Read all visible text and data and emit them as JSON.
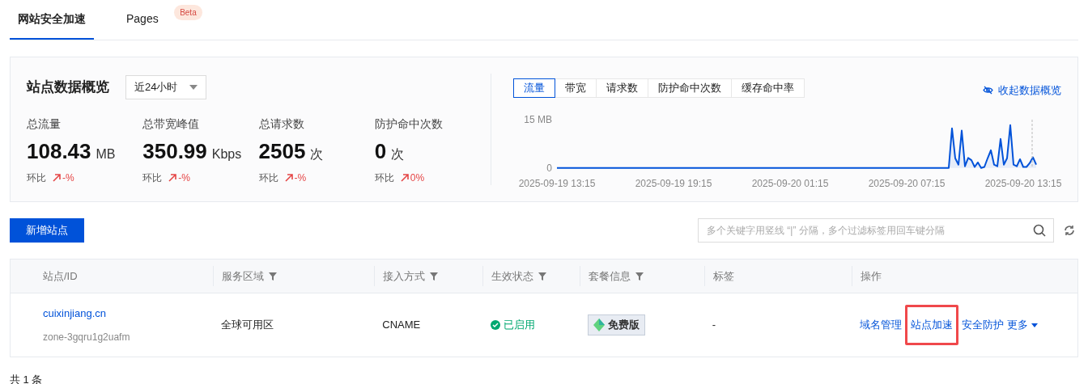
{
  "tabs": [
    {
      "label": "网站安全加速",
      "selected": true
    },
    {
      "label": "Pages",
      "selected": false,
      "badge": "Beta"
    }
  ],
  "overview": {
    "title": "站点数据概览",
    "range": "近24小时",
    "metrics": [
      {
        "label": "总流量",
        "value": "108.43",
        "unit": "MB",
        "compare_label": "环比",
        "compare": "-%"
      },
      {
        "label": "总带宽峰值",
        "value": "350.99",
        "unit": "Kbps",
        "compare_label": "环比",
        "compare": "-%"
      },
      {
        "label": "总请求数",
        "value": "2505",
        "unit": "次",
        "compare_label": "环比",
        "compare": "-%"
      },
      {
        "label": "防护命中次数",
        "value": "0",
        "unit": "次",
        "compare_label": "环比",
        "compare": "0%"
      }
    ],
    "chart_tabs": [
      {
        "label": "流量",
        "selected": true
      },
      {
        "label": "带宽",
        "selected": false
      },
      {
        "label": "请求数",
        "selected": false
      },
      {
        "label": "防护命中次数",
        "selected": false
      },
      {
        "label": "缓存命中率",
        "selected": false
      }
    ],
    "collapse_link": "收起数据概览",
    "chart_data": {
      "type": "line",
      "categories": [
        "2025-09-19 13:15",
        null,
        null,
        null,
        null,
        null,
        null,
        null,
        null,
        null,
        null,
        null,
        null,
        null,
        null,
        null,
        null,
        null,
        null,
        null,
        null,
        null,
        null,
        null,
        null,
        null,
        null,
        null,
        null,
        null,
        null,
        null,
        null,
        null,
        null,
        null,
        "2025-09-19 19:15",
        null,
        null,
        null,
        null,
        null,
        null,
        null,
        null,
        null,
        null,
        null,
        null,
        null,
        null,
        null,
        null,
        null,
        null,
        null,
        null,
        null,
        null,
        null,
        null,
        null,
        null,
        null,
        null,
        null,
        null,
        null,
        null,
        null,
        null,
        null,
        "2025-09-20 01:15",
        null,
        null,
        null,
        null,
        null,
        null,
        null,
        null,
        null,
        null,
        null,
        null,
        null,
        null,
        null,
        null,
        null,
        null,
        null,
        null,
        null,
        null,
        null,
        null,
        null,
        null,
        null,
        null,
        null,
        null,
        null,
        null,
        null,
        null,
        null,
        "2025-09-20 07:15",
        null,
        null,
        null,
        null,
        null,
        null,
        null,
        null,
        null,
        null,
        null,
        null,
        null,
        null,
        null,
        null,
        null,
        null,
        null,
        null,
        null,
        null,
        null,
        null,
        null,
        null,
        null,
        null,
        null,
        null,
        null,
        null,
        null,
        null,
        null,
        "2025-09-20 13:15",
        null,
        null,
        null,
        null
      ],
      "series": [
        {
          "color": "#0052d9",
          "values": [
            0,
            0,
            0,
            0,
            0,
            0,
            0,
            0,
            0,
            0,
            0,
            0,
            0,
            0,
            0,
            0,
            0,
            0,
            0,
            0,
            0,
            0,
            0,
            0,
            0,
            0,
            0,
            0,
            0,
            0,
            0,
            0,
            0,
            0,
            0,
            0,
            0,
            0,
            0,
            0,
            0,
            0,
            0,
            0,
            0,
            0,
            0,
            0,
            0,
            0,
            0,
            0,
            0,
            0,
            0,
            0,
            0,
            0,
            0,
            0,
            0,
            0,
            0,
            0,
            0,
            0,
            0,
            0,
            0,
            0,
            0,
            0,
            0,
            0,
            0,
            0,
            0,
            0,
            0,
            0,
            0,
            0,
            0,
            0,
            0,
            0,
            0,
            0,
            0,
            0,
            0,
            0,
            0,
            0,
            0,
            0,
            0,
            0,
            0,
            0,
            0,
            0,
            0,
            0,
            0,
            0,
            0,
            0,
            0,
            0,
            0,
            0,
            0,
            0,
            0,
            0,
            0,
            0,
            0,
            0,
            0,
            0,
            12.3,
            3,
            1,
            11.6,
            0.5,
            3.1,
            2.4,
            0.3,
            1.7,
            0,
            0.3,
            3,
            5.5,
            1,
            0.5,
            9,
            1,
            3,
            13.3,
            1,
            0.5,
            2.7,
            0.3,
            0.3,
            1.5,
            3.3,
            1
          ]
        }
      ],
      "ylim": [
        0,
        15
      ],
      "yticks": [
        {
          "value": 0,
          "label": "0"
        },
        {
          "value": 15,
          "label": "15 MB"
        }
      ]
    }
  },
  "add_button": "新增站点",
  "search": {
    "placeholder": "多个关键字用竖线 “|” 分隔，多个过滤标签用回车键分隔"
  },
  "table": {
    "columns": [
      {
        "label": "站点/ID",
        "filter": false
      },
      {
        "label": "服务区域",
        "filter": true
      },
      {
        "label": "接入方式",
        "filter": true
      },
      {
        "label": "生效状态",
        "filter": true
      },
      {
        "label": "套餐信息",
        "filter": true
      },
      {
        "label": "标签",
        "filter": false
      },
      {
        "label": "操作",
        "filter": false
      }
    ],
    "rows": [
      {
        "site": "cuixinjiang.cn",
        "id": "zone-3gqru1g2uafm",
        "region": "全球可用区",
        "access": "CNAME",
        "status": "已启用",
        "plan": "免费版",
        "tags": "-",
        "actions": [
          {
            "label": "域名管理",
            "highlighted": false
          },
          {
            "label": "站点加速",
            "highlighted": true
          },
          {
            "label": "安全防护",
            "highlighted": false
          },
          {
            "label": "更多",
            "highlighted": false,
            "dropdown": true
          }
        ]
      }
    ]
  },
  "footer": "共 1 条"
}
